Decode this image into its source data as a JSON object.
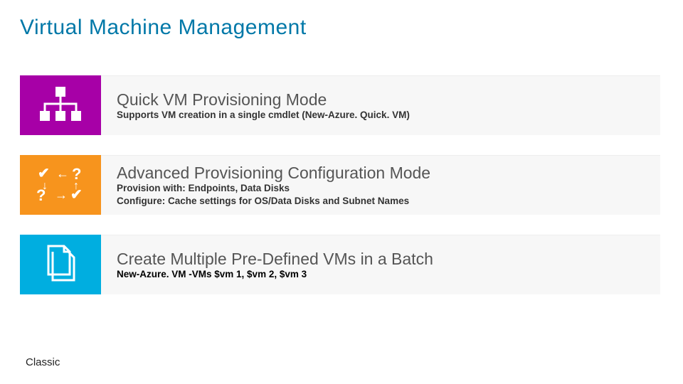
{
  "page": {
    "title": "Virtual Machine Management",
    "footer_label": "Classic"
  },
  "items": [
    {
      "icon_name": "hierarchy-icon",
      "tile_color": "#a700a7",
      "heading": "Quick VM Provisioning Mode",
      "description": "Supports VM creation in a single cmdlet (New-Azure. Quick. VM)",
      "code": ""
    },
    {
      "icon_name": "checks-arrows-icon",
      "tile_color": "#f7941d",
      "heading": "Advanced Provisioning Configuration Mode",
      "description": "Provision with: Endpoints, Data Disks\nConfigure: Cache settings for OS/Data Disks and Subnet Names",
      "code": ""
    },
    {
      "icon_name": "documents-icon",
      "tile_color": "#00aee0",
      "heading": "Create Multiple Pre-Defined VMs in a Batch",
      "description": "",
      "code": "New-Azure. VM -VMs $vm 1, $vm 2, $vm 3"
    }
  ]
}
